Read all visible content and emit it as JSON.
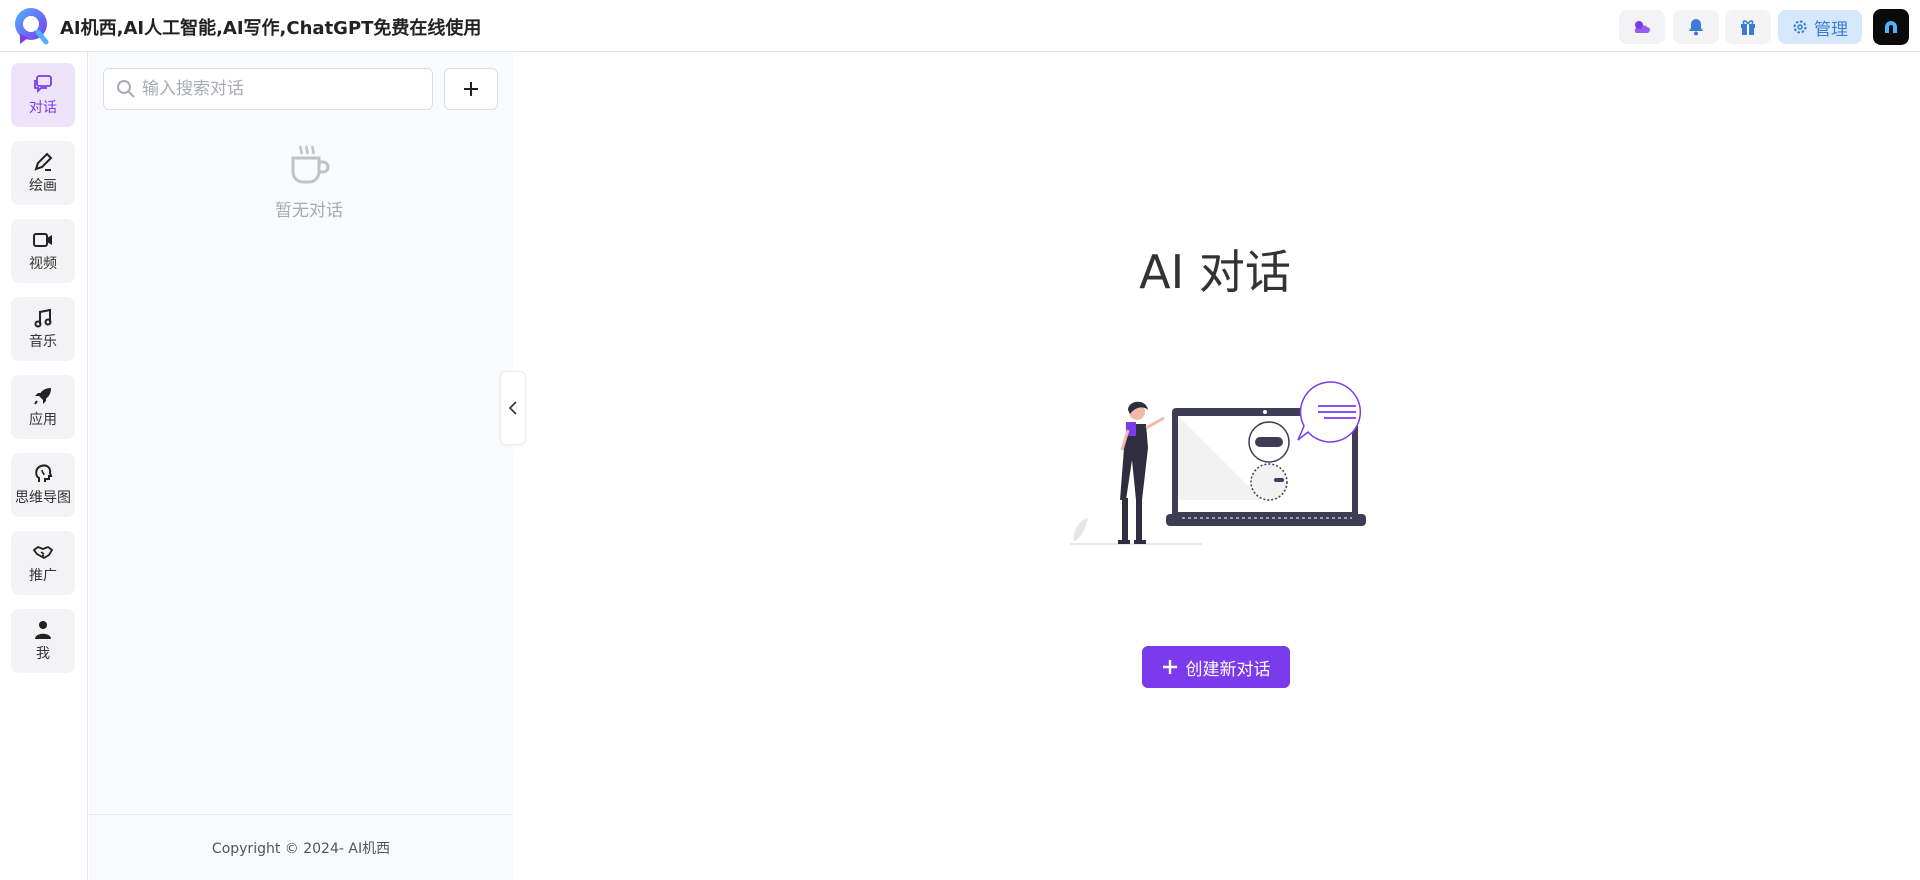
{
  "header": {
    "site_title": "AI机西,AI人工智能,AI写作,ChatGPT免费在线使用",
    "admin_label": "管理",
    "icons": [
      "theme-icon",
      "bell-icon",
      "gift-icon",
      "gear-icon"
    ]
  },
  "rail": {
    "items": [
      {
        "label": "对话",
        "icon": "chat-icon"
      },
      {
        "label": "绘画",
        "icon": "pen-icon"
      },
      {
        "label": "视频",
        "icon": "video-icon"
      },
      {
        "label": "音乐",
        "icon": "music-icon"
      },
      {
        "label": "应用",
        "icon": "rocket-icon"
      },
      {
        "label": "思维导图",
        "icon": "brain-icon"
      },
      {
        "label": "推广",
        "icon": "handshake-icon"
      },
      {
        "label": "我",
        "icon": "user-icon"
      }
    ]
  },
  "panel": {
    "search_placeholder": "输入搜索对话",
    "empty_text": "暂无对话",
    "copyright": "Copyright © 2024-  AI机西"
  },
  "main": {
    "title": "AI 对话",
    "create_label": "创建新对话"
  },
  "colors": {
    "accent": "#7c3aed",
    "admin_bg": "#d5e8fb",
    "admin_text": "#3a7bd5"
  }
}
